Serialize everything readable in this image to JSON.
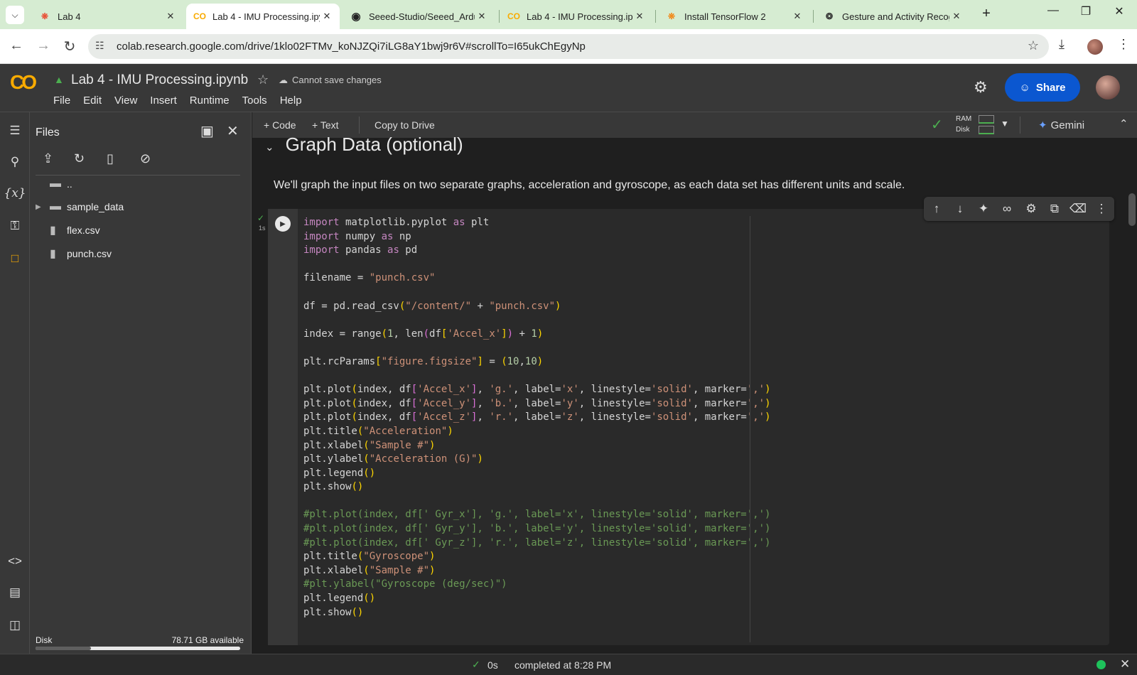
{
  "browser": {
    "tabs": [
      {
        "title": "Lab 4",
        "favicon": "gear-icon",
        "active": false
      },
      {
        "title": "Lab 4 - IMU Processing.ipy",
        "favicon": "colab-icon",
        "active": true
      },
      {
        "title": "Seeed-Studio/Seeed_Ardui",
        "favicon": "github-icon",
        "active": false
      },
      {
        "title": "Lab 4 - IMU Processing.ipy",
        "favicon": "colab-icon",
        "active": false
      },
      {
        "title": "Install TensorFlow 2",
        "favicon": "tensorflow-icon",
        "active": false
      },
      {
        "title": "Gesture and Activity Recog",
        "favicon": "openai-icon",
        "active": false
      }
    ],
    "url": "colab.research.google.com/drive/1klo02FTMv_koNJZQi7iLG8aY1bwj9r6V#scrollTo=I65ukChEgyNp",
    "colors": {
      "tabbar": "#d6ecd2",
      "accent": "#0b57d0"
    }
  },
  "colab": {
    "logo": "CO",
    "notebook_title": "Lab 4 - IMU Processing.ipynb",
    "cannot_save": "Cannot save changes",
    "menu": [
      "File",
      "Edit",
      "View",
      "Insert",
      "Runtime",
      "Tools",
      "Help"
    ],
    "share_label": "Share"
  },
  "files_panel": {
    "title": "Files",
    "items": [
      {
        "name": "..",
        "type": "folder-up"
      },
      {
        "name": "sample_data",
        "type": "folder"
      },
      {
        "name": "flex.csv",
        "type": "file"
      },
      {
        "name": "punch.csv",
        "type": "file"
      }
    ],
    "disk_label": "Disk",
    "disk_available": "78.71 GB available",
    "disk_used_percent": 27
  },
  "toolbar": {
    "code": "+ Code",
    "text": "+ Text",
    "copy_to_drive": "Copy to Drive",
    "ram": "RAM",
    "disk": "Disk",
    "gemini": "Gemini"
  },
  "section": {
    "title": "Graph Data (optional)",
    "description": "We'll graph the input files on two separate graphs, acceleration and gyroscope, as each data set has different units and scale."
  },
  "cell": {
    "exec_time": "1s"
  },
  "statusbar": {
    "seconds": "0s",
    "text": "completed at 8:28 PM"
  }
}
